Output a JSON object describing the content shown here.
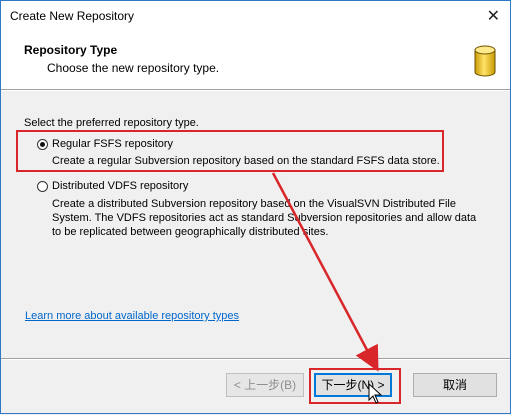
{
  "window": {
    "title": "Create New Repository",
    "close_glyph": "✕"
  },
  "header": {
    "title": "Repository Type",
    "subtitle": "Choose the new repository type.",
    "icon": "database-icon",
    "icon_color": "#e8b600"
  },
  "body": {
    "prompt": "Select the preferred repository type.",
    "options": [
      {
        "label": "Regular FSFS repository",
        "description": "Create a regular Subversion repository based on the standard FSFS data store.",
        "selected": true
      },
      {
        "label": "Distributed VDFS repository",
        "description": "Create a distributed Subversion repository based on the VisualSVN Distributed File System. The VDFS repositories act as standard Subversion repositories and allow data to be replicated between geographically distributed sites.",
        "selected": false
      }
    ],
    "learn_more_link": "Learn more about available repository types"
  },
  "buttons": {
    "back": "< 上一步(B)",
    "next": "下一步(N) >",
    "cancel": "取消"
  },
  "annotation_color": "#d9262a"
}
